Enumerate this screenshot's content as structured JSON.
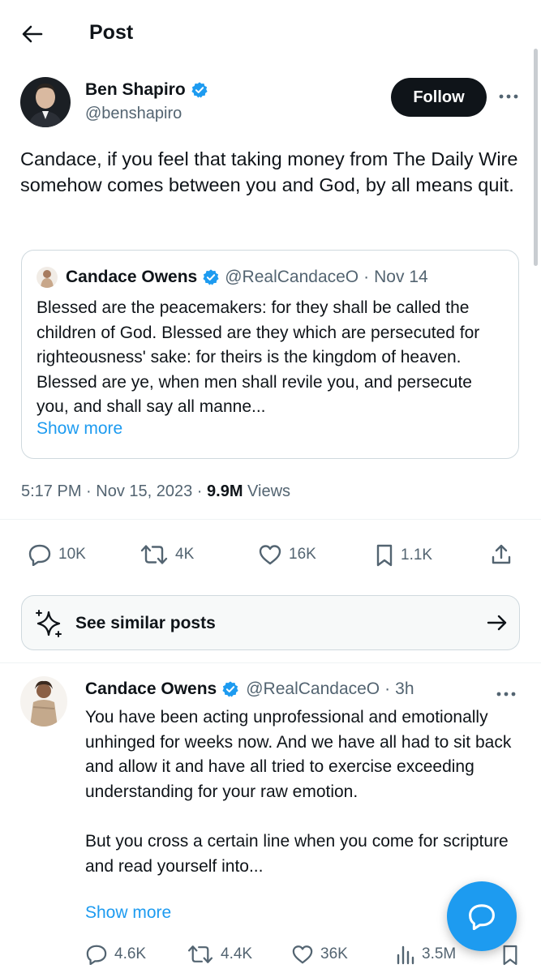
{
  "header": {
    "title": "Post"
  },
  "post": {
    "author_name": "Ben Shapiro",
    "author_handle": "@benshapiro",
    "follow_label": "Follow",
    "text": "Candace, if you feel that taking money from The Daily Wire somehow comes between you and God, by all means quit.",
    "quote": {
      "name": "Candace Owens",
      "handle": "@RealCandaceO",
      "separator": "·",
      "date": "Nov 14",
      "text": "Blessed are the peacemakers: for they shall be called the children of God. Blessed are they which are persecuted for righteousness' sake: for theirs is the kingdom of heaven. Blessed are ye, when men shall revile you, and persecute you, and shall say all manne...",
      "show_more": "Show more"
    },
    "timestamp": "5:17 PM · Nov 15, 2023 ·",
    "views_count": "9.9M",
    "views_label": "Views",
    "stats": {
      "replies": "10K",
      "reposts": "4K",
      "likes": "16K",
      "bookmarks": "1.1K"
    }
  },
  "similar": {
    "label": "See similar posts"
  },
  "reply": {
    "name": "Candace Owens",
    "handle": "@RealCandaceO",
    "separator": "·",
    "time": "3h",
    "text": "You have been acting unprofessional and emotionally unhinged  for weeks now. And we have all had to sit back and allow it and have all tried to exercise exceeding understanding for your raw emotion.\n\nBut you cross a certain line when you come for scripture and read yourself into...",
    "show_more": "Show more",
    "stats": {
      "replies": "4.6K",
      "reposts": "4.4K",
      "likes": "36K",
      "views": "3.5M"
    }
  },
  "colors": {
    "accent": "#1d9bf0",
    "verified": "#1d9bf0",
    "text_primary": "#0f1419",
    "text_secondary": "#536471",
    "border": "#cfd9de"
  },
  "icons": [
    "back-arrow-icon",
    "verified-badge-icon",
    "more-icon",
    "reply-icon",
    "repost-icon",
    "like-icon",
    "bookmark-icon",
    "share-icon",
    "sparkle-icon",
    "arrow-right-icon",
    "views-icon",
    "compose-message-icon"
  ]
}
